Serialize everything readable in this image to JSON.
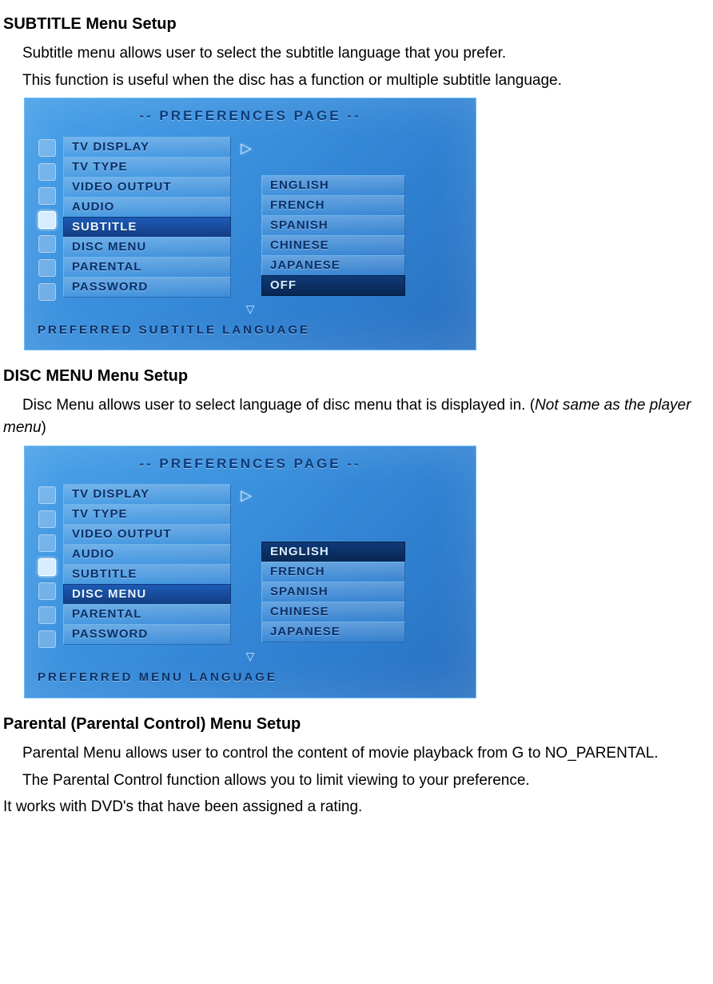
{
  "section1": {
    "heading": "SUBTITLE Menu Setup",
    "p1": "Subtitle menu allows user to select the subtitle language that you prefer.",
    "p2": "This function is useful when the disc has a function or multiple subtitle language."
  },
  "osd1": {
    "title": "-- PREFERENCES PAGE --",
    "menu": [
      "TV DISPLAY",
      "TV TYPE",
      "VIDEO OUTPUT",
      "AUDIO",
      "SUBTITLE",
      "DISC MENU",
      "PARENTAL",
      "PASSWORD"
    ],
    "selectedMenuIndex": 4,
    "options": [
      "ENGLISH",
      "FRENCH",
      "SPANISH",
      "CHINESE",
      "JAPANESE",
      "OFF"
    ],
    "selectedOptionIndex": 5,
    "footer": "PREFERRED SUBTITLE LANGUAGE"
  },
  "section2": {
    "heading": "DISC MENU Menu Setup",
    "p1a": "Disc Menu allows user to select language of disc menu that is displayed in. (",
    "p1b": "Not same as the player menu",
    "p1c": ")"
  },
  "osd2": {
    "title": "-- PREFERENCES PAGE --",
    "menu": [
      "TV DISPLAY",
      "TV TYPE",
      "VIDEO OUTPUT",
      "AUDIO",
      "SUBTITLE",
      "DISC MENU",
      "PARENTAL",
      "PASSWORD"
    ],
    "selectedMenuIndex": 5,
    "options": [
      "ENGLISH",
      "FRENCH",
      "SPANISH",
      "CHINESE",
      "JAPANESE"
    ],
    "selectedOptionIndex": 0,
    "footer": "PREFERRED MENU LANGUAGE"
  },
  "section3": {
    "heading": "Parental (Parental Control) Menu Setup",
    "p1": "Parental Menu allows user to control the content of movie playback from G to NO_PARENTAL.",
    "p2": "The Parental Control function allows you to limit viewing to your preference.",
    "p3": "It works with DVD's that have been assigned a rating."
  }
}
